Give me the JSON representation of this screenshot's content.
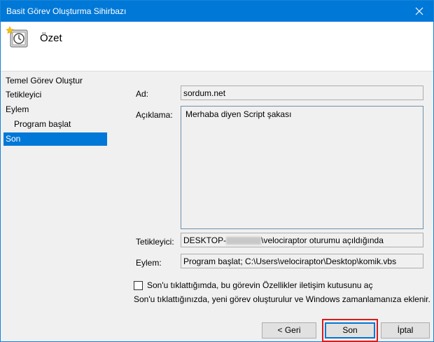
{
  "window": {
    "title": "Basit Görev Oluşturma Sihirbazı"
  },
  "header": {
    "title": "Özet"
  },
  "nav": {
    "items": [
      {
        "label": "Temel Görev Oluştur"
      },
      {
        "label": "Tetikleyici"
      },
      {
        "label": "Eylem"
      },
      {
        "label": "Program başlat"
      },
      {
        "label": "Son"
      }
    ]
  },
  "form": {
    "name_label": "Ad:",
    "name_value": "sordum.net",
    "desc_label": "Açıklama:",
    "desc_value": "Merhaba diyen Script şakası",
    "trigger_label": "Tetikleyici:",
    "trigger_value_prefix": "DESKTOP-",
    "trigger_value_suffix": "\\velociraptor oturumu açıldığında",
    "action_label": "Eylem:",
    "action_value": "Program başlat; C:\\Users\\velociraptor\\Desktop\\komik.vbs"
  },
  "options": {
    "checkbox_label": "Son'u tıklattığımda, bu görevin Özellikler iletişim kutusunu aç",
    "checkbox_checked": false,
    "info_text": "Son'u tıklattığınızda, yeni görev oluşturulur ve Windows zamanlamanıza eklenir."
  },
  "buttons": {
    "back_label": "< Geri",
    "finish_label": "Son",
    "cancel_label": "İptal"
  },
  "colors": {
    "accent": "#0078d7",
    "highlight": "#d81b1b"
  }
}
